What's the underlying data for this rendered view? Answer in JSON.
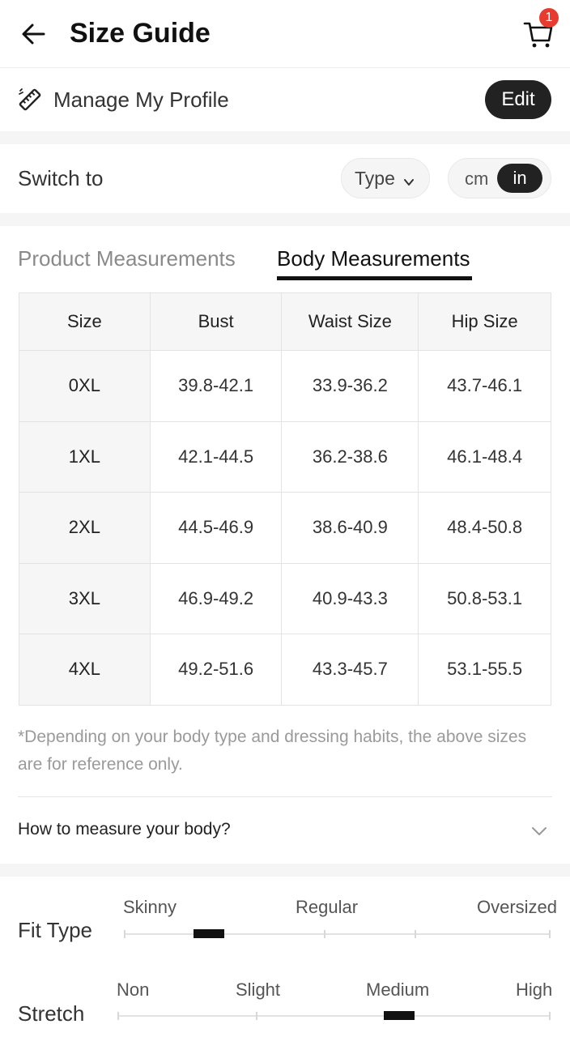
{
  "header": {
    "title": "Size Guide",
    "cart_count": "1"
  },
  "profile": {
    "label": "Manage My Profile",
    "edit_label": "Edit"
  },
  "switch": {
    "label": "Switch to",
    "type_label": "Type",
    "unit_cm": "cm",
    "unit_in": "in",
    "selected_unit": "in"
  },
  "tabs": [
    {
      "label": "Product Measurements",
      "active": false
    },
    {
      "label": "Body Measurements",
      "active": true
    }
  ],
  "table": {
    "headers": [
      "Size",
      "Bust",
      "Waist Size",
      "Hip Size"
    ],
    "rows": [
      [
        "0XL",
        "39.8-42.1",
        "33.9-36.2",
        "43.7-46.1"
      ],
      [
        "1XL",
        "42.1-44.5",
        "36.2-38.6",
        "46.1-48.4"
      ],
      [
        "2XL",
        "44.5-46.9",
        "38.6-40.9",
        "48.4-50.8"
      ],
      [
        "3XL",
        "46.9-49.2",
        "40.9-43.3",
        "50.8-53.1"
      ],
      [
        "4XL",
        "49.2-51.6",
        "43.3-45.7",
        "53.1-55.5"
      ]
    ]
  },
  "note": "*Depending on your body type and dressing habits, the above sizes are for reference only.",
  "measure": {
    "label": "How to measure your body?"
  },
  "fit_type": {
    "title": "Fit Type",
    "labels": [
      "Skinny",
      "Regular",
      "Oversized"
    ],
    "value": 0.2
  },
  "stretch": {
    "title": "Stretch",
    "labels": [
      "Non",
      "Slight",
      "Medium",
      "High"
    ],
    "value": 0.65
  }
}
